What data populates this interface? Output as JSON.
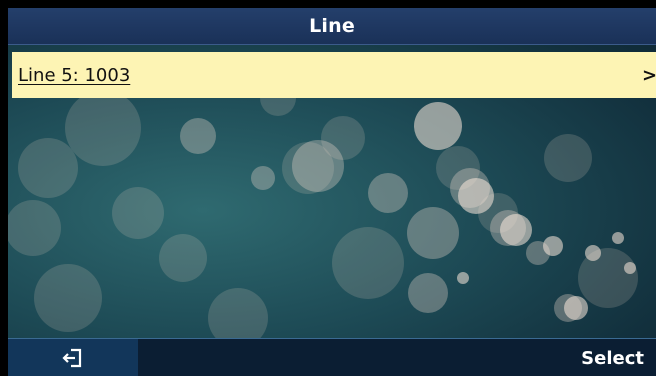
{
  "header": {
    "title": "Line"
  },
  "list": {
    "items": [
      {
        "label": "Line 5: 1003",
        "indicator": ">"
      }
    ]
  },
  "softkeys": {
    "back_icon": "back-icon",
    "select_label": "Select"
  },
  "colors": {
    "title_bar": "#1f3864",
    "selected_item": "#fdf4b4",
    "softkey_bar": "#0b1e33",
    "softkey_active": "#12365a"
  }
}
